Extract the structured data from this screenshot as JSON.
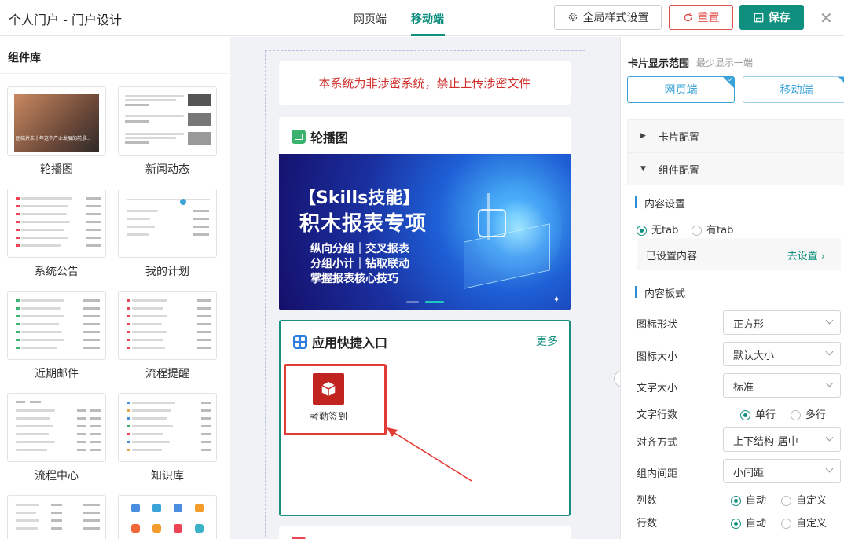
{
  "header": {
    "title": "个人门户 - 门户设计",
    "tabs": [
      "网页端",
      "移动端"
    ],
    "global_style_label": "全局样式设置",
    "reset_label": "重置",
    "save_label": "保存"
  },
  "library": {
    "title": "组件库",
    "items": [
      "轮播图",
      "新闻动态",
      "系统公告",
      "我的计划",
      "近期邮件",
      "流程提醒",
      "流程中心",
      "知识库"
    ],
    "banner_thumb_text": "团结并未十年这个产业发展的前景..."
  },
  "canvas": {
    "notice": "本系统为非涉密系统，禁止上传涉密文件",
    "carousel_title": "轮播图",
    "banner": {
      "line1": "【Skills技能】",
      "line2": "积木报表专项",
      "line3": "纵向分组｜交叉报表",
      "line4": "分组小计｜钻取联动",
      "line5": "掌握报表核心技巧"
    },
    "shortcut_title": "应用快捷入口",
    "more_label": "更多",
    "app_label": "考勤签到"
  },
  "panel": {
    "range_title": "卡片显示范围",
    "range_hint": "最少显示一端",
    "range_web": "网页端",
    "range_mobile": "移动端",
    "card_config": "卡片配置",
    "component_config": "组件配置",
    "content_settings": "内容设置",
    "no_tab": "无tab",
    "has_tab": "有tab",
    "content_set": "已设置内容",
    "go_set": "去设置",
    "content_layout": "内容板式",
    "rows": [
      {
        "label": "图标形状",
        "value": "正方形"
      },
      {
        "label": "图标大小",
        "value": "默认大小"
      },
      {
        "label": "文字大小",
        "value": "标准"
      }
    ],
    "text_lines_label": "文字行数",
    "text_lines_options": [
      "单行",
      "多行"
    ],
    "align_label": "对齐方式",
    "align_value": "上下结构-居中",
    "spacing_label": "组内间距",
    "spacing_value": "小间距",
    "columns_label": "列数",
    "rows_label": "行数",
    "auto_label": "自动",
    "custom_label": "自定义"
  },
  "colors": {
    "accent": "#0f8f7e",
    "danger": "#e2504a",
    "notice_red": "#d0312d",
    "link_blue": "#3aa3d8"
  }
}
